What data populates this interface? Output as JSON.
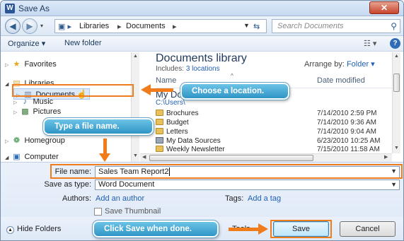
{
  "window": {
    "title": "Save As",
    "app_icon": "W",
    "close_glyph": "✕"
  },
  "address": {
    "crumbs": [
      "Libraries",
      "Documents"
    ],
    "search_placeholder": "Search Documents"
  },
  "toolbar": {
    "organize": "Organize ▾",
    "new_folder": "New folder"
  },
  "nav": {
    "favorites": "Favorites",
    "libraries": "Libraries",
    "documents": "Documents",
    "music": "Music",
    "pictures": "Pictures",
    "homegroup": "Homegroup",
    "computer": "Computer"
  },
  "library": {
    "title": "Documents library",
    "includes_label": "Includes:",
    "includes_link": "3 locations",
    "arrange_label": "Arrange by:",
    "arrange_value": "Folder ▾",
    "col_name": "Name",
    "col_date": "Date modified",
    "group_title": "My Do",
    "group_path": "C:\\Users\\",
    "files": [
      {
        "name": "Brochures",
        "date": "7/14/2010 2:59 PM",
        "icon": "folder-icon"
      },
      {
        "name": "Budget",
        "date": "7/14/2010 9:36 AM",
        "icon": "folder-icon"
      },
      {
        "name": "Letters",
        "date": "7/14/2010 9:04 AM",
        "icon": "folder-icon"
      },
      {
        "name": "My Data Sources",
        "date": "6/23/2010 10:25 AM",
        "icon": "data-source-icon"
      },
      {
        "name": "Weekly Newsletter",
        "date": "7/15/2010 11:58 AM",
        "icon": "folder-icon"
      }
    ]
  },
  "form": {
    "file_name_label": "File name:",
    "file_name_value": "Sales Team Report2",
    "save_type_label": "Save as type:",
    "save_type_value": "Word Document",
    "authors_label": "Authors:",
    "authors_value": "Add an author",
    "tags_label": "Tags:",
    "tags_value": "Add a tag",
    "thumbnail_label": "Save Thumbnail"
  },
  "bottom": {
    "hide_folders": "Hide Folders",
    "tools": "Tools",
    "save": "Save",
    "cancel": "Cancel"
  },
  "callouts": {
    "location": "Choose a location.",
    "filename": "Type a file name.",
    "save": "Click Save when done."
  },
  "colors": {
    "callout": "#2f95c6",
    "highlight": "#f07c1c"
  }
}
